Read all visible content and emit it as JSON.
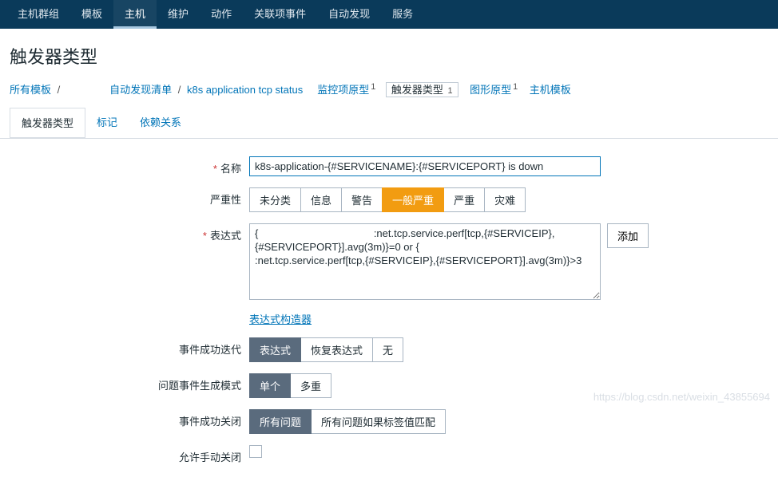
{
  "topnav": {
    "items": [
      "主机群组",
      "模板",
      "主机",
      "维护",
      "动作",
      "关联项事件",
      "自动发现",
      "服务"
    ],
    "active_index": 2
  },
  "page_title": "触发器类型",
  "breadcrumb": {
    "all_templates": "所有模板",
    "sep": "/",
    "blurred_template": "                ",
    "discovery_list": "自动发现清单",
    "discovery_rule": "k8s application tcp status",
    "items": [
      {
        "label": "监控项原型",
        "count": "1"
      },
      {
        "label": "触发器类型",
        "count": "1",
        "outlined": true
      },
      {
        "label": "图形原型",
        "count": "1"
      },
      {
        "label": "主机模板",
        "count": ""
      }
    ]
  },
  "subtabs": {
    "items": [
      "触发器类型",
      "标记",
      "依赖关系"
    ],
    "active_index": 0
  },
  "form": {
    "name_label": "名称",
    "name_value": "k8s-application-{#SERVICENAME}:{#SERVICEPORT} is down",
    "severity_label": "严重性",
    "severity_options": [
      "未分类",
      "信息",
      "警告",
      "一般严重",
      "严重",
      "灾难"
    ],
    "severity_selected_index": 3,
    "expr_label": "表达式",
    "expr_value": "{                                        :net.tcp.service.perf[tcp,{#SERVICEIP},{#SERVICEPORT}].avg(3m)}=0 or {                              :net.tcp.service.perf[tcp,{#SERVICEIP},{#SERVICEPORT}].avg(3m)}>3",
    "add_label": "添加",
    "expr_builder": "表达式构造器",
    "ok_iter_label": "事件成功迭代",
    "ok_iter_options": [
      "表达式",
      "恢复表达式",
      "无"
    ],
    "ok_iter_selected_index": 0,
    "gen_mode_label": "问题事件生成模式",
    "gen_mode_options": [
      "单个",
      "多重"
    ],
    "gen_mode_selected_index": 0,
    "ok_close_label": "事件成功关闭",
    "ok_close_options": [
      "所有问题",
      "所有问题如果标签值匹配"
    ],
    "ok_close_selected_index": 0,
    "manual_close_label": "允许手动关闭"
  },
  "watermark": "https://blog.csdn.net/weixin_43855694"
}
